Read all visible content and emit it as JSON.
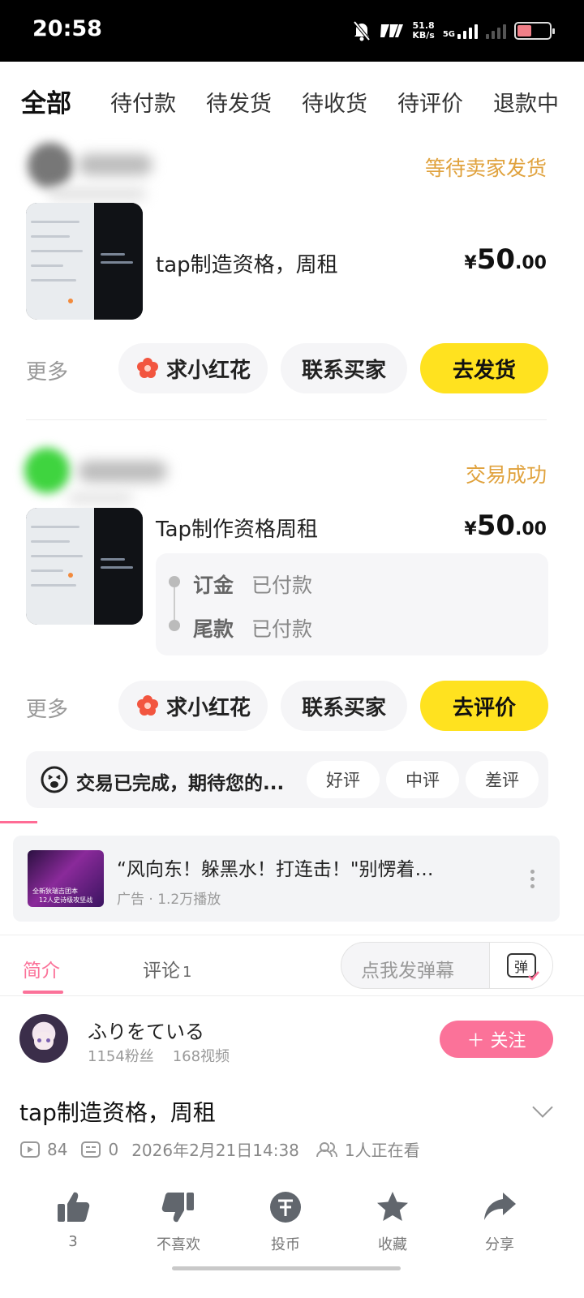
{
  "status_bar": {
    "time": "20:58",
    "net_speed_value": "51.8",
    "net_speed_unit": "KB/s",
    "network": "5G",
    "battery_percent": 45
  },
  "order_tabs": [
    "全部",
    "待付款",
    "待发货",
    "待收货",
    "待评价",
    "退款中"
  ],
  "orders": [
    {
      "status": "等待卖家发货",
      "title": "tap制造资格，周租",
      "price_currency": "¥",
      "price_int": "50",
      "price_dec": ".00",
      "more": "更多",
      "btn_flower": "求小红花",
      "btn_contact": "联系买家",
      "btn_primary": "去发货"
    },
    {
      "status": "交易成功",
      "title": "Tap制作资格周租",
      "price_currency": "¥",
      "price_int": "50",
      "price_dec": ".00",
      "deposit_label": "订金",
      "deposit_status": "已付款",
      "balance_label": "尾款",
      "balance_status": "已付款",
      "more": "更多",
      "btn_flower": "求小红花",
      "btn_contact": "联系买家",
      "btn_primary": "去评价"
    }
  ],
  "review": {
    "text": "交易已完成，期待您的...",
    "good": "好评",
    "neutral": "中评",
    "bad": "差评"
  },
  "ad": {
    "title": "“风向东！躲黑水！打连击！\"别愣着…",
    "meta": "广告 · 1.2万播放",
    "thumb_line1": "全新狄瑞吉团本",
    "thumb_line2": "12人史诗级攻坚战"
  },
  "video_tabs": {
    "intro": "简介",
    "comments": "评论",
    "comments_count": "1",
    "danmu_placeholder": "点我发弹幕",
    "danmu_icon_text": "弹"
  },
  "uploader": {
    "name": "ふりをている",
    "fans": "1154粉丝",
    "videos": "168视频",
    "follow": "＋ 关注"
  },
  "video": {
    "title": "tap制造资格，周租",
    "plays": "84",
    "danmaku": "0",
    "date": "2026年2月21日14:38",
    "watching": "1人正在看"
  },
  "actions": {
    "like": "3",
    "dislike": "不喜欢",
    "coin": "投币",
    "favorite": "收藏",
    "share": "分享"
  },
  "colors": {
    "accent_yellow": "#ffe21f",
    "status_orange": "#e0a23d",
    "bili_pink": "#fb7299"
  }
}
